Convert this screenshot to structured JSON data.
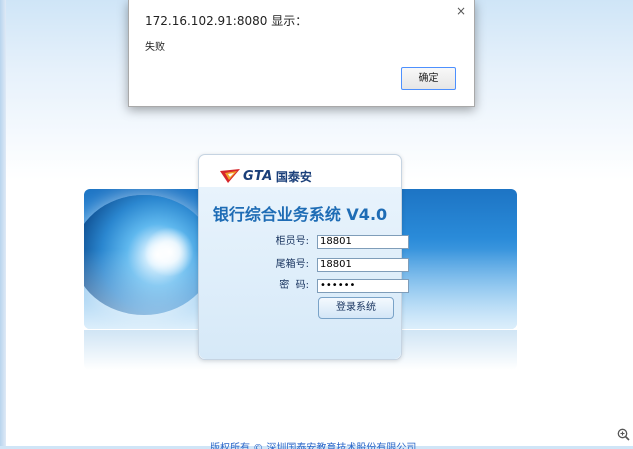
{
  "dialog": {
    "title": "172.16.102.91:8080 显示：",
    "message": "失败",
    "ok_label": "确定",
    "close_glyph": "×"
  },
  "login": {
    "logo_text": "GTA",
    "logo_cn": "国泰安",
    "system_title": "银行综合业务系统",
    "version": "V4.0",
    "teller_label": "柜员号:",
    "teller_value": "18801",
    "terminal_label": "尾箱号:",
    "terminal_value": "18801",
    "password_label": "密  码:",
    "password_value": "••••••",
    "login_button": "登录系统"
  },
  "footer": {
    "link_text": "版权所有 © 深圳国泰安教育技术股份有限公司"
  },
  "colors": {
    "accent": "#1e6cb5",
    "logo_red": "#d6262b",
    "logo_orange": "#f2a12a"
  },
  "icons": {
    "zoom": "zoom-in-icon",
    "logo": "gta-logo-mark-icon"
  }
}
